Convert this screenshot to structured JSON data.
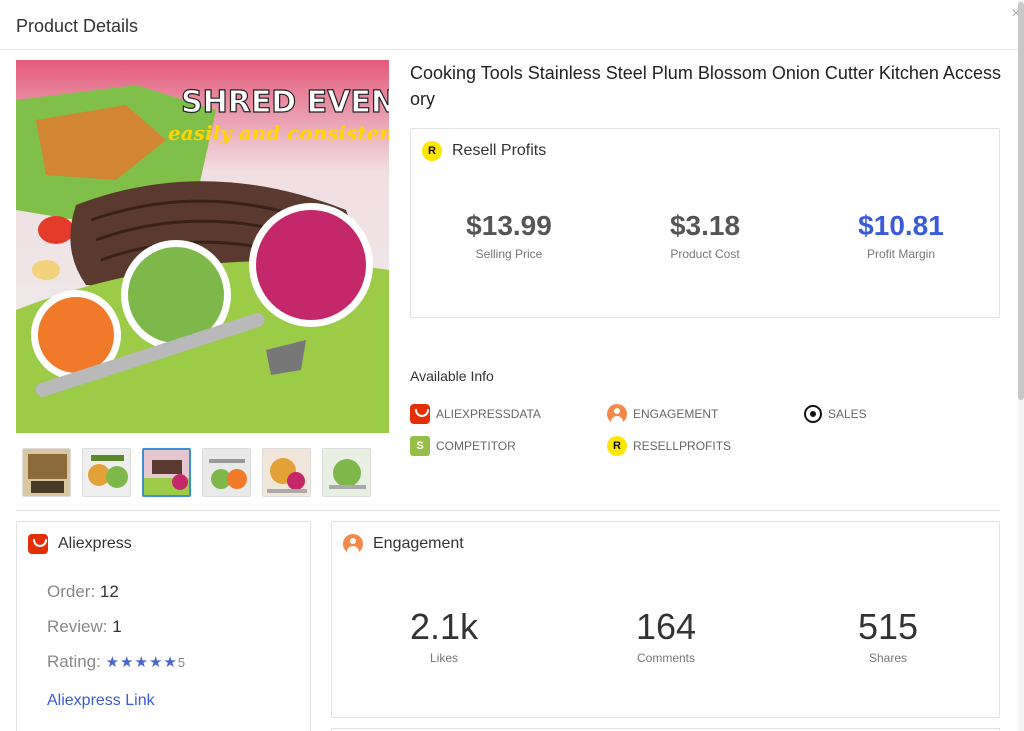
{
  "modal": {
    "title": "Product Details",
    "close_symbol": "×"
  },
  "product": {
    "title": "Cooking Tools Stainless Steel Plum Blossom Onion Cutter Kitchen Accessory",
    "image_headline": "SHRED EVENLY",
    "image_subline": "easily and consistently"
  },
  "resell": {
    "title": "Resell Profits",
    "badge": "R",
    "selling_price": {
      "value": "$13.99",
      "label": "Selling Price"
    },
    "product_cost": {
      "value": "$3.18",
      "label": "Product Cost"
    },
    "profit_margin": {
      "value": "$10.81",
      "label": "Profit Margin"
    }
  },
  "available_info": {
    "title": "Available Info",
    "items": [
      {
        "label": "ALIEXPRESSDATA",
        "icon": "aliexpress-icon"
      },
      {
        "label": "ENGAGEMENT",
        "icon": "engagement-icon"
      },
      {
        "label": "SALES",
        "icon": "target-icon"
      },
      {
        "label": "COMPETITOR",
        "icon": "shopify-icon"
      },
      {
        "label": "RESELLPROFITS",
        "icon": "resell-icon"
      }
    ]
  },
  "aliexpress": {
    "title": "Aliexpress",
    "order_label": "Order:",
    "order_value": "12",
    "review_label": "Review:",
    "review_value": "1",
    "rating_label": "Rating:",
    "stars": "★★★★★",
    "rating_value": "5",
    "rating_number": 5,
    "link_label": "Aliexpress Link"
  },
  "engagement": {
    "title": "Engagement",
    "likes": {
      "value": "2.1k",
      "label": "Likes"
    },
    "comments": {
      "value": "164",
      "label": "Comments"
    },
    "shares": {
      "value": "515",
      "label": "Shares"
    }
  },
  "colors": {
    "accent_blue": "#3a5bd9",
    "aliexpress_red": "#e62e04",
    "engagement_orange": "#f5894a",
    "resell_yellow": "#ffe600",
    "shopify_green": "#95bf47"
  }
}
